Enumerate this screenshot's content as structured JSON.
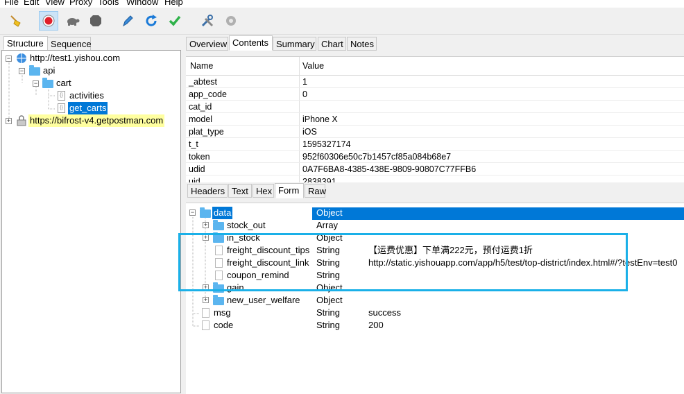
{
  "menu": [
    "File",
    "Edit",
    "View",
    "Proxy",
    "Tools",
    "Window",
    "Help"
  ],
  "toolbar": [
    "broom-icon",
    "record-icon",
    "turtle-icon",
    "stop-icon",
    "pen-icon",
    "refresh-icon",
    "check-icon",
    "tools-icon",
    "settings-icon"
  ],
  "left_tabs": [
    "Structure",
    "Sequence"
  ],
  "tree": {
    "host1": "http://test1.yishou.com",
    "api": "api",
    "cart": "cart",
    "activities": "activities",
    "get_carts": "get_carts",
    "host2": "https://bifrost-v4.getpostman.com"
  },
  "top_tabs": [
    "Overview",
    "Contents",
    "Summary",
    "Chart",
    "Notes"
  ],
  "params": {
    "headers": [
      "Name",
      "Value"
    ],
    "rows": [
      [
        "_abtest",
        "1"
      ],
      [
        "app_code",
        "0"
      ],
      [
        "cat_id",
        ""
      ],
      [
        "model",
        "iPhone X"
      ],
      [
        "plat_type",
        "iOS"
      ],
      [
        "t_t",
        "1595327174"
      ],
      [
        "token",
        "952f60306e50c7b1457cf85a084b68e7"
      ],
      [
        "udid",
        "0A7F6BA8-4385-438E-9809-90807C77FFB6"
      ],
      [
        "uid",
        "2838391"
      ]
    ]
  },
  "bottom_tabs": [
    "Headers",
    "Text",
    "Hex",
    "Form",
    "Raw"
  ],
  "response_tree": [
    {
      "name": "data",
      "type": "Object",
      "value": ""
    },
    {
      "name": "stock_out",
      "type": "Array",
      "value": ""
    },
    {
      "name": "in_stock",
      "type": "Object",
      "value": ""
    },
    {
      "name": "freight_discount_tips",
      "type": "String",
      "value": "【运费优惠】下单满222元，预付运费1折"
    },
    {
      "name": "freight_discount_link",
      "type": "String",
      "value": "http://static.yishouapp.com/app/h5/test/top-district/index.html#/?testEnv=test0"
    },
    {
      "name": "coupon_remind",
      "type": "String",
      "value": ""
    },
    {
      "name": "gain",
      "type": "Object",
      "value": ""
    },
    {
      "name": "new_user_welfare",
      "type": "Object",
      "value": ""
    },
    {
      "name": "msg",
      "type": "String",
      "value": "success"
    },
    {
      "name": "code",
      "type": "String",
      "value": "200"
    }
  ],
  "colors": {
    "selection": "#0078d7",
    "highlight_box": "#1ab0e8",
    "host_highlight": "#ffffa0"
  }
}
